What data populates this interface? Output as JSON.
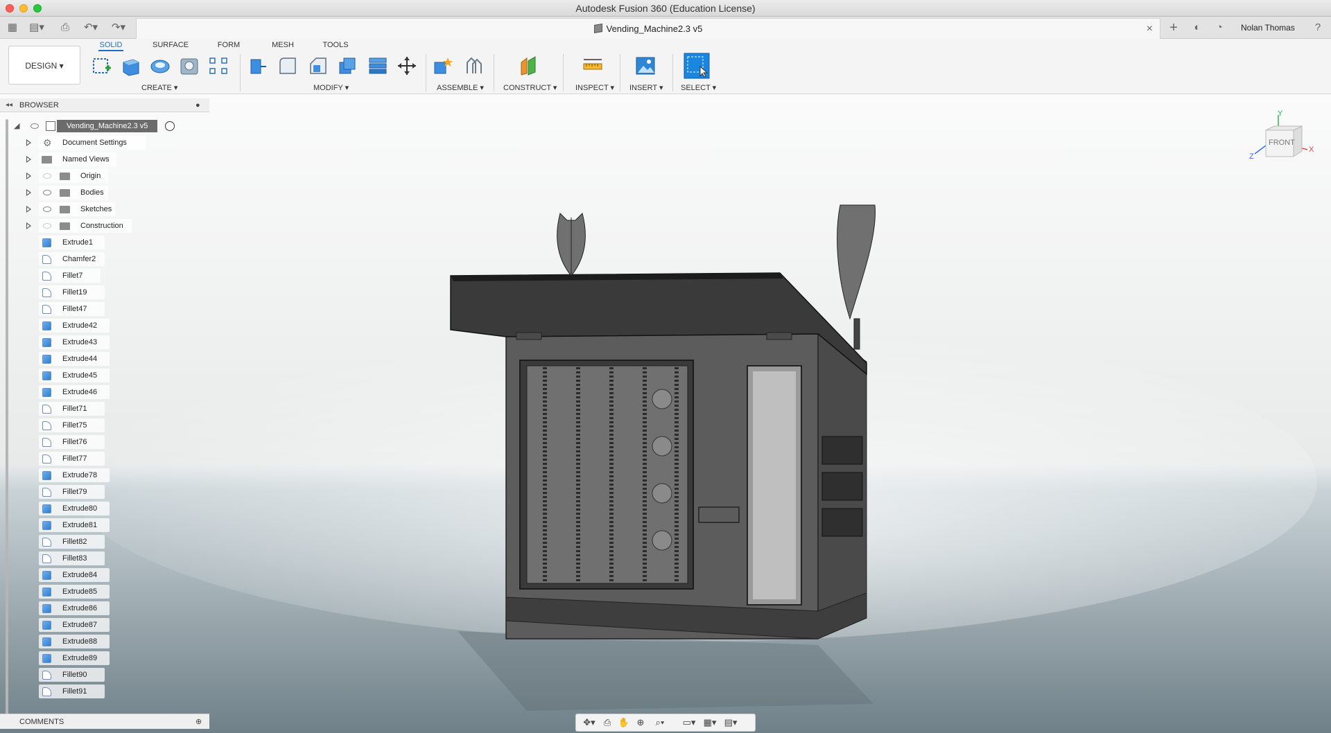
{
  "window": {
    "title": "Autodesk Fusion 360 (Education License)"
  },
  "tabbar": {
    "document_title": "Vending_Machine2.3 v5",
    "user_name": "Nolan Thomas"
  },
  "toolbar": {
    "workspace_label": "DESIGN",
    "tabs": [
      "SOLID",
      "SURFACE",
      "FORM",
      "MESH",
      "TOOLS"
    ],
    "active_tab": "SOLID",
    "groups": {
      "create": "CREATE",
      "modify": "MODIFY",
      "assemble": "ASSEMBLE",
      "construct": "CONSTRUCT",
      "inspect": "INSPECT",
      "insert": "INSERT",
      "select": "SELECT"
    },
    "accent_color": "#1a6fc9"
  },
  "browser": {
    "header": "BROWSER",
    "root": "Vending_Machine2.3 v5",
    "folders": [
      "Document Settings",
      "Named Views",
      "Origin",
      "Bodies",
      "Sketches",
      "Construction"
    ],
    "features": [
      {
        "label": "Extrude1",
        "type": "extrude"
      },
      {
        "label": "Chamfer2",
        "type": "fillet"
      },
      {
        "label": "Fillet7",
        "type": "fillet"
      },
      {
        "label": "Fillet19",
        "type": "fillet"
      },
      {
        "label": "Fillet47",
        "type": "fillet"
      },
      {
        "label": "Extrude42",
        "type": "extrude"
      },
      {
        "label": "Extrude43",
        "type": "extrude"
      },
      {
        "label": "Extrude44",
        "type": "extrude"
      },
      {
        "label": "Extrude45",
        "type": "extrude"
      },
      {
        "label": "Extrude46",
        "type": "extrude"
      },
      {
        "label": "Fillet71",
        "type": "fillet"
      },
      {
        "label": "Fillet75",
        "type": "fillet"
      },
      {
        "label": "Fillet76",
        "type": "fillet"
      },
      {
        "label": "Fillet77",
        "type": "fillet"
      },
      {
        "label": "Extrude78",
        "type": "extrude"
      },
      {
        "label": "Fillet79",
        "type": "fillet"
      },
      {
        "label": "Extrude80",
        "type": "extrude"
      },
      {
        "label": "Extrude81",
        "type": "extrude"
      },
      {
        "label": "Fillet82",
        "type": "fillet"
      },
      {
        "label": "Fillet83",
        "type": "fillet"
      },
      {
        "label": "Extrude84",
        "type": "extrude"
      },
      {
        "label": "Extrude85",
        "type": "extrude"
      },
      {
        "label": "Extrude86",
        "type": "extrude"
      },
      {
        "label": "Extrude87",
        "type": "extrude"
      },
      {
        "label": "Extrude88",
        "type": "extrude"
      },
      {
        "label": "Extrude89",
        "type": "extrude"
      },
      {
        "label": "Fillet90",
        "type": "fillet"
      },
      {
        "label": "Fillet91",
        "type": "fillet"
      }
    ]
  },
  "comments": {
    "header": "COMMENTS"
  },
  "viewcube": {
    "face_label": "FRONT",
    "axis_y": "Y",
    "axis_x": "X",
    "axis_z": "Z"
  }
}
